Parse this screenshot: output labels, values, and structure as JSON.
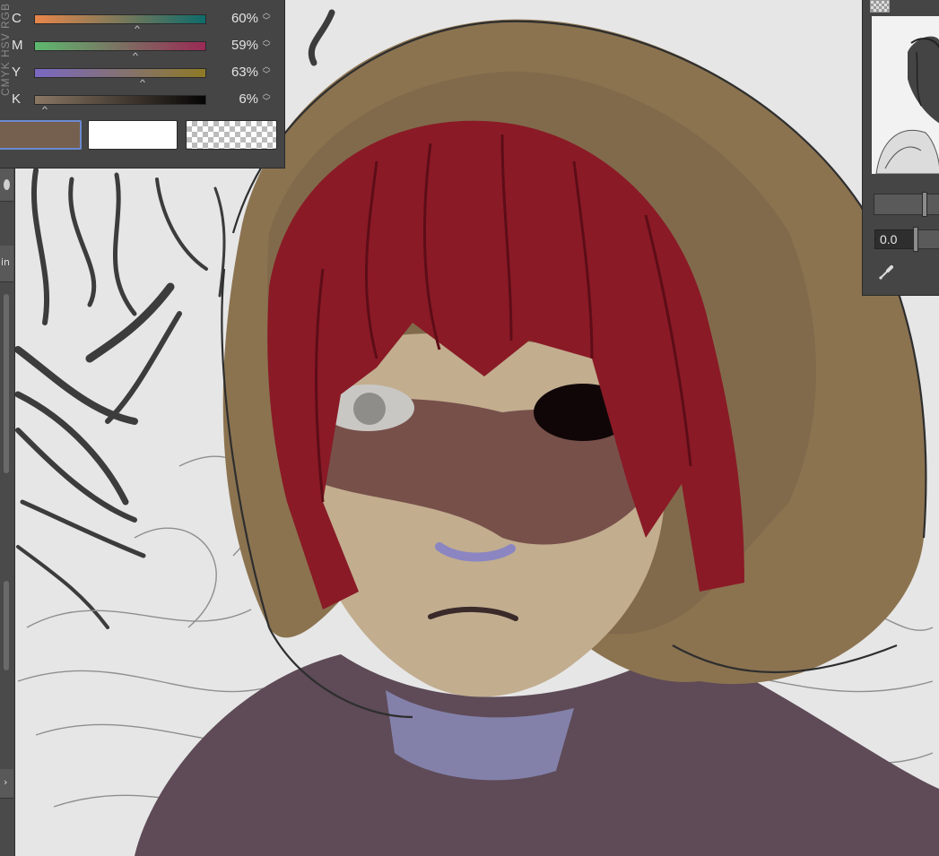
{
  "color_panel": {
    "mode_tabs": "CMYK  HSV  RGB",
    "sliders": [
      {
        "channel": "C",
        "value": "60%",
        "level": 0.6,
        "gradient_start": "#e8864a",
        "gradient_end": "#0e6b6a"
      },
      {
        "channel": "M",
        "value": "59%",
        "level": 0.59,
        "gradient_start": "#5db86f",
        "gradient_end": "#9a2a55"
      },
      {
        "channel": "Y",
        "value": "63%",
        "level": 0.63,
        "gradient_start": "#7a68c4",
        "gradient_end": "#8e7a25"
      },
      {
        "channel": "K",
        "value": "6%",
        "level": 0.06,
        "gradient_start": "#8a7764",
        "gradient_end": "#050505"
      }
    ],
    "swatches": {
      "main_color": "#75604f",
      "sub_color": "#ffffff",
      "transparent": "transparent"
    },
    "spin_icon": "up-down-arrows-icon",
    "knob_icon": "caret-up-icon"
  },
  "navigator": {
    "rotation_value": "0.0",
    "eyedropper_icon": "eyedropper-icon",
    "transparency_icon": "checkerboard-icon"
  },
  "left_strip": {
    "item_1": "in"
  },
  "colors": {
    "panel_bg": "#454545",
    "canvas_bg": "#e6e6e6",
    "hood": "#8b7350",
    "hair": "#8a1a26",
    "skin": "#c2ad8f",
    "scarf": "#5e4b57",
    "selection_border": "#6a8ad0"
  }
}
